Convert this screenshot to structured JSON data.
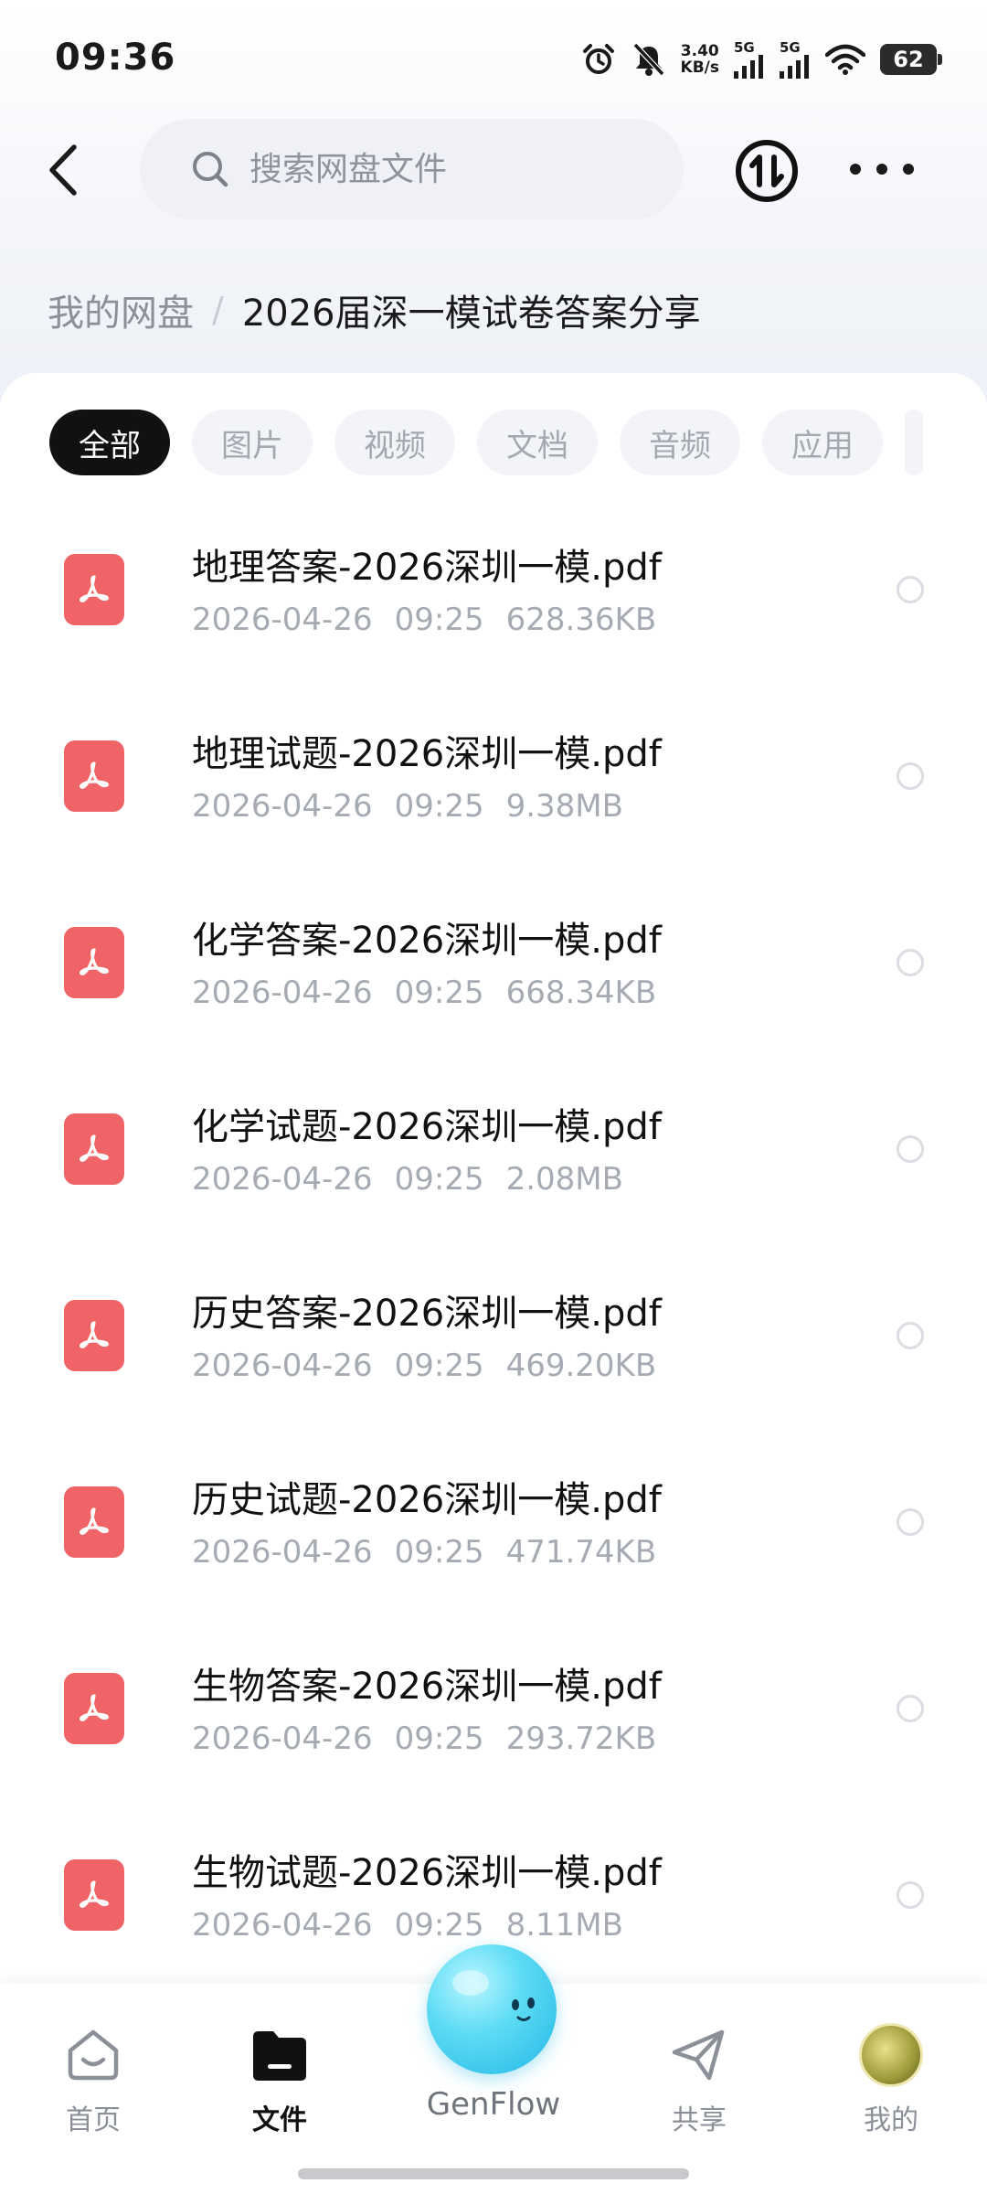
{
  "status_bar": {
    "time": "09:36",
    "net_speed_value": "3.40",
    "net_speed_unit": "KB/s",
    "sim1_label": "5G",
    "sim2_label": "5G",
    "battery": "62"
  },
  "header": {
    "search_placeholder": "搜索网盘文件"
  },
  "breadcrumb": {
    "root": "我的网盘",
    "separator": "/",
    "current": "2026届深一模试卷答案分享"
  },
  "tabs": [
    {
      "label": "全部",
      "active": true
    },
    {
      "label": "图片",
      "active": false
    },
    {
      "label": "视频",
      "active": false
    },
    {
      "label": "文档",
      "active": false
    },
    {
      "label": "音频",
      "active": false
    },
    {
      "label": "应用",
      "active": false
    }
  ],
  "files": [
    {
      "name": "地理答案-2026深圳一模.pdf",
      "date": "2026-04-26",
      "time": "09:25",
      "size": "628.36KB"
    },
    {
      "name": "地理试题-2026深圳一模.pdf",
      "date": "2026-04-26",
      "time": "09:25",
      "size": "9.38MB"
    },
    {
      "name": "化学答案-2026深圳一模.pdf",
      "date": "2026-04-26",
      "time": "09:25",
      "size": "668.34KB"
    },
    {
      "name": "化学试题-2026深圳一模.pdf",
      "date": "2026-04-26",
      "time": "09:25",
      "size": "2.08MB"
    },
    {
      "name": "历史答案-2026深圳一模.pdf",
      "date": "2026-04-26",
      "time": "09:25",
      "size": "469.20KB"
    },
    {
      "name": "历史试题-2026深圳一模.pdf",
      "date": "2026-04-26",
      "time": "09:25",
      "size": "471.74KB"
    },
    {
      "name": "生物答案-2026深圳一模.pdf",
      "date": "2026-04-26",
      "time": "09:25",
      "size": "293.72KB"
    },
    {
      "name": "生物试题-2026深圳一模.pdf",
      "date": "2026-04-26",
      "time": "09:25",
      "size": "8.11MB"
    }
  ],
  "bottom_nav": {
    "home": "首页",
    "files": "文件",
    "genflow": "GenFlow",
    "share": "共享",
    "mine": "我的"
  },
  "colors": {
    "pdf_icon": "#f06468",
    "genflow_accent": "#22b7e6",
    "active_tab": "#111111"
  }
}
